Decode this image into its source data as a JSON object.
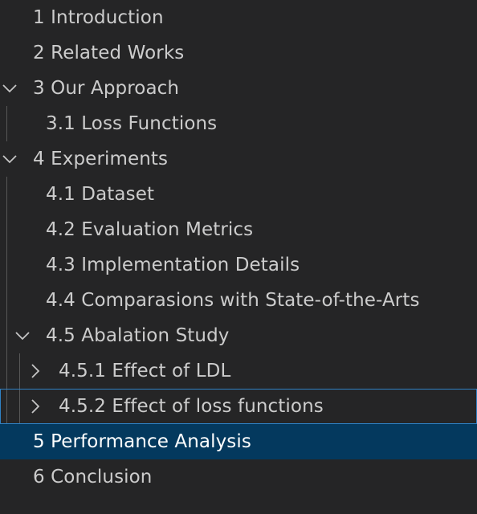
{
  "outline": {
    "items": [
      {
        "label": "1 Introduction",
        "level": 0,
        "twistie": "none"
      },
      {
        "label": "2 Related Works",
        "level": 0,
        "twistie": "none"
      },
      {
        "label": "3 Our Approach",
        "level": 0,
        "twistie": "expanded"
      },
      {
        "label": "3.1 Loss Functions",
        "level": 1,
        "twistie": "none"
      },
      {
        "label": "4 Experiments",
        "level": 0,
        "twistie": "expanded"
      },
      {
        "label": "4.1 Dataset",
        "level": 1,
        "twistie": "none"
      },
      {
        "label": "4.2 Evaluation Metrics",
        "level": 1,
        "twistie": "none"
      },
      {
        "label": "4.3 Implementation Details",
        "level": 1,
        "twistie": "none"
      },
      {
        "label": "4.4 Comparasions with State-of-the-Arts",
        "level": 1,
        "twistie": "none"
      },
      {
        "label": "4.5 Abalation Study",
        "level": 1,
        "twistie": "expanded"
      },
      {
        "label": "4.5.1 Effect of LDL",
        "level": 2,
        "twistie": "collapsed"
      },
      {
        "label": "4.5.2 Effect of loss functions",
        "level": 2,
        "twistie": "collapsed",
        "focused": true
      },
      {
        "label": "5 Performance Analysis",
        "level": 0,
        "twistie": "none",
        "selected": true
      },
      {
        "label": "6 Conclusion",
        "level": 0,
        "twistie": "none"
      }
    ]
  },
  "colors": {
    "background": "#252526",
    "text": "#cccccc",
    "selected_background": "#04395e",
    "selected_text": "#ffffff",
    "focus_border": "#2f81c4",
    "indent_guide": "#585858"
  },
  "icons": {
    "expanded": "chevron-down-icon",
    "collapsed": "chevron-right-icon"
  }
}
